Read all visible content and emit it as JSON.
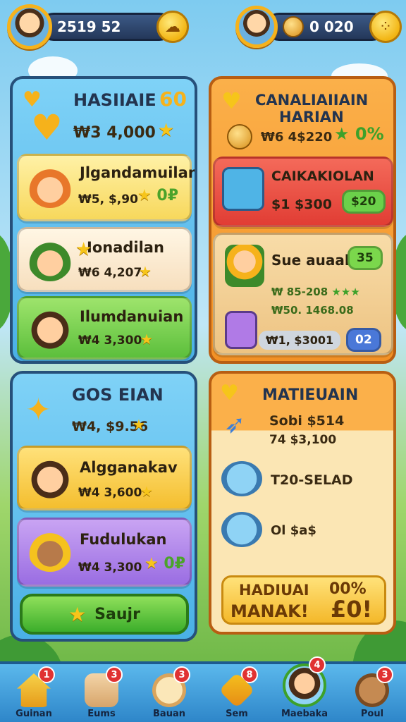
{
  "topbar": {
    "left_value": "2519 52",
    "right_value": "0  020"
  },
  "panel_left_top": {
    "title": "HASIIAIE",
    "title_badge": "60",
    "price": "₩3 4,000",
    "items": [
      {
        "name": "Jlgandamuilan",
        "price": "₩5, $,90",
        "tag": "0₽"
      },
      {
        "name": "Ionadilan",
        "price": "₩6 4,207"
      },
      {
        "name": "Ilumdanuian",
        "price": "₩4 3,300"
      }
    ]
  },
  "panel_left_bottom": {
    "title": "GOS EIAN",
    "price": "₩4, $9.56",
    "items": [
      {
        "name": "Algganakav",
        "price": "₩4 3,600"
      },
      {
        "name": "Fudulukan",
        "price": "₩4 3,300",
        "tag": "0₽"
      }
    ],
    "button_label": "Saujr"
  },
  "panel_right_top": {
    "title_line1": "CANALIAIIAIN",
    "title_line2": "HARIAN",
    "price": "₩6 4$220",
    "tag": "0%",
    "items": [
      {
        "name": "CAIKAKIOLAN",
        "price": "$1 $300",
        "button": "$20"
      },
      {
        "name": "Sue auaal",
        "button": "35",
        "line1": "₩ 85-208",
        "line2": "₩50. 1468.08"
      },
      {
        "name": "",
        "price": "₩1, $3001",
        "button": "02"
      }
    ]
  },
  "panel_right_bottom": {
    "title": "MATIEUAIN",
    "line1": "Sobi $514",
    "line2": "74 $3,100",
    "item1": "T20-SELAD",
    "item2": "Ol $a$",
    "promo_line1": "HADIUAI",
    "promo_line2": "MANAK!",
    "promo_value1": "00%",
    "promo_value2": "£0!"
  },
  "nav": {
    "items": [
      {
        "label": "Guinan",
        "badge": "1",
        "icon": "house-icon"
      },
      {
        "label": "Eums",
        "badge": "3",
        "icon": "scroll-icon"
      },
      {
        "label": "Bauan",
        "badge": "3",
        "icon": "bread-icon"
      },
      {
        "label": "Sem",
        "badge": "8",
        "icon": "swords-icon"
      },
      {
        "label": "Maebaka",
        "badge": "4",
        "icon": "character-icon"
      },
      {
        "label": "Poul",
        "badge": "3",
        "icon": "pet-icon"
      }
    ]
  },
  "colors": {
    "panel_blue": "#4ab0e6",
    "panel_orange": "#f39125",
    "gold": "#f6b21b",
    "badge_red": "#e03232"
  }
}
